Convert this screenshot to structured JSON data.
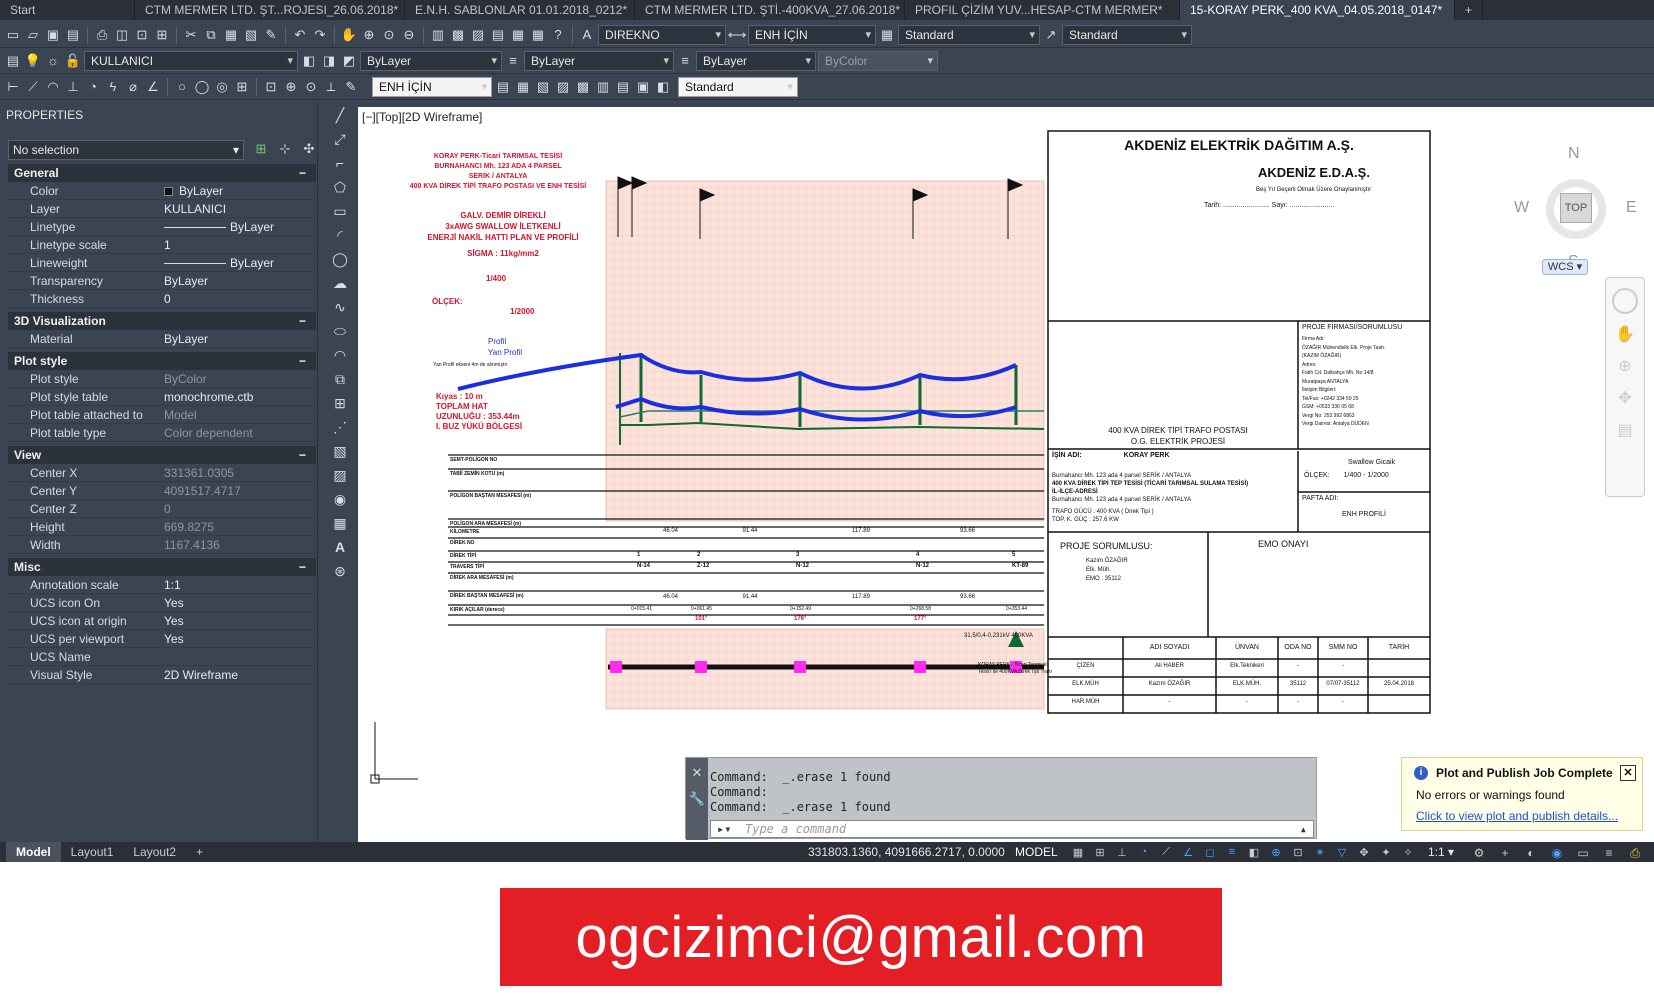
{
  "tabs": [
    {
      "label": "Start"
    },
    {
      "label": "CTM MERMER LTD. ŞT...ROJESI_26.06.2018*"
    },
    {
      "label": "E.N.H. SABLONLAR 01.01.2018_0212*"
    },
    {
      "label": "CTM MERMER LTD. ŞTİ.-400KVA_27.06.2018*"
    },
    {
      "label": "PROFIL ÇİZİM YUV...HESAP-CTM MERMER*"
    },
    {
      "label": "15-KORAY PERK_400 KVA_04.05.2018_0147*"
    }
  ],
  "toolbar1": {
    "textstyle": "DIREKNO",
    "dimstyle": "ENH İÇİN",
    "tablestyle": "Standard",
    "mleaderstyle": "Standard"
  },
  "toolbar2": {
    "layer": "KULLANICI",
    "color": "ByLayer",
    "linetype": "ByLayer",
    "lineweight": "ByLayer",
    "plotstyle": "ByColor"
  },
  "toolbar3": {
    "dimstyle": "ENH İÇİN",
    "standard": "Standard"
  },
  "properties": {
    "title": "PROPERTIES",
    "selection": "No selection",
    "sections": {
      "general": "General",
      "viz3d": "3D Visualization",
      "plot": "Plot style",
      "view": "View",
      "misc": "Misc"
    },
    "general": [
      {
        "k": "Color",
        "v": "ByLayer"
      },
      {
        "k": "Layer",
        "v": "KULLANICI"
      },
      {
        "k": "Linetype",
        "v": "ByLayer"
      },
      {
        "k": "Linetype scale",
        "v": "1"
      },
      {
        "k": "Lineweight",
        "v": "ByLayer"
      },
      {
        "k": "Transparency",
        "v": "ByLayer"
      },
      {
        "k": "Thickness",
        "v": "0"
      }
    ],
    "viz3d": [
      {
        "k": "Material",
        "v": "ByLayer"
      }
    ],
    "plot": [
      {
        "k": "Plot style",
        "v": "ByColor"
      },
      {
        "k": "Plot style table",
        "v": "monochrome.ctb"
      },
      {
        "k": "Plot table attached to",
        "v": "Model"
      },
      {
        "k": "Plot table type",
        "v": "Color dependent"
      }
    ],
    "view": [
      {
        "k": "Center X",
        "v": "331361.0305"
      },
      {
        "k": "Center Y",
        "v": "4091517.4717"
      },
      {
        "k": "Center Z",
        "v": "0"
      },
      {
        "k": "Height",
        "v": "669.8275"
      },
      {
        "k": "Width",
        "v": "1167.4136"
      }
    ],
    "misc": [
      {
        "k": "Annotation scale",
        "v": "1:1"
      },
      {
        "k": "UCS icon On",
        "v": "Yes"
      },
      {
        "k": "UCS icon at origin",
        "v": "Yes"
      },
      {
        "k": "UCS per viewport",
        "v": "Yes"
      },
      {
        "k": "UCS Name",
        "v": ""
      },
      {
        "k": "Visual Style",
        "v": "2D Wireframe"
      }
    ]
  },
  "viewport": {
    "label": "[−][Top][2D Wireframe]",
    "viewcube": {
      "top": "TOP",
      "n": "N",
      "s": "S",
      "e": "E",
      "w": "W"
    },
    "wcs": "WCS ▾",
    "drawing": {
      "title_red": [
        "KORAY PERK-Ticari TARIMSAL TESİSİ",
        "BURNAHANCI Mh. 123 ADA 4 PARSEL",
        "SERİK / ANTALYA",
        "400 KVA DİREK TİPİ TRAFO POSTASI VE ENH TESİSİ"
      ],
      "galv": [
        "GALV. DEMİR DİREKLİ",
        "3xAWG SWALLOW İLETKENLİ",
        "ENERJİ NAKİL HATTI PLAN VE PROFİLİ"
      ],
      "sigma": "SİGMA : 11kg/mm2",
      "scale_v": "1/400",
      "scale_h": "1/2000",
      "scale_label": "ÖLÇEK:",
      "legend": [
        "Profil",
        "Yan Profil"
      ],
      "legend_note": "Yan Profil ekseni 4m de alınmıştır",
      "kiyas": "Kıyas : 10 m",
      "toplam": "TOPLAM HAT",
      "uzunluk": "UZUNLUĞU : 353.44m",
      "buz": "I. BUZ YÜKÜ BÖLGESİ",
      "table_rows": [
        "SEMT-POLİGON NO",
        "TABİİ ZEMİN KOTU (m)",
        "POLİGON BAŞTAN MESAFESİ (m)",
        "POLİGON ARA MESAFESİ (m)",
        "KİLOMETRE",
        "DİREK NO",
        "DİREK TİPİ",
        "TRAVERS TİPİ",
        "DİREK ARA MESAFESİ (m)",
        "DİREK BAŞTAN MESAFESİ (m)",
        "KIRIK AÇILAR (derece)"
      ],
      "poles": [
        "1",
        "2",
        "3",
        "4",
        "5"
      ],
      "pole_types": [
        "N-14",
        "Z-12",
        "N-12",
        "N-12",
        "KT-89"
      ],
      "spans": [
        "46.04",
        "91.44",
        "117.89",
        "93.66"
      ],
      "distances": [
        "0+015.41",
        "0+061.45",
        "0+152.49",
        "0+268.58",
        "0+353.44"
      ],
      "angles": [
        "101°",
        "176°",
        "177°"
      ],
      "trafo_note": "KORAY PERK - Ticari Tarımsal Tesis'i ile 400KVA Direk Tipi Trafo",
      "end_label": "31,5/0,4-0,231kV 400KVA"
    },
    "titleblock": {
      "company": "AKDENİZ ELEKTRİK DAĞITIM A.Ş.",
      "company_short": "AKDENİZ E.D.A.Ş.",
      "approval": "Beş Yıl Geçerli Olmak Üzere Onaylanmıştır",
      "date_label": "Tarih: ........................ Sayı: .......................",
      "project_title": [
        "400 KVA DİREK TİPİ TRAFO POSTASI",
        "O.G. ELEKTRİK PROJESİ"
      ],
      "firm_label": "PROJE FİRMASI/SORUMLUSU",
      "firm_lines": [
        "Firma Adı:",
        "ÖZAĞIR Mühendislik Elk. Proje Taah.",
        "(KAZIM ÖZAĞIR)",
        "Adres:",
        "Fatih Cd. Dalbahçe Mh. No:14/8",
        "Muratpaşa ANTALYA",
        "İletişim Bilgileri:",
        "Tel/Fax: +0242 334 59 25",
        "GSM: +0533 336 05 68",
        "Vergi No: 253 992 6863",
        "Vergi Dairesi: Antalya DÜDEN"
      ],
      "work_name_label": "İŞİN ADI:",
      "work_name": "KORAY PERK",
      "work_desc": "400 KVA DİREK TİPİ TEP TESİSİ (TİCARİ TARIMSAL SULAMA TESİSİ)",
      "il_ilce": "İL-İLÇE-ADRESİ",
      "address": "Burnahancı Mh. 123 ada 4 parsel SERİK / ANTALYA",
      "trafo_gucu": "TRAFO GÜCÜ : 400 KVA ( Direk Tipi )",
      "top_kguc": "TOP. K. GÜÇ : 257.6 KW",
      "conductor": "Swallow Gicaik",
      "scale_label": "ÖLÇEK:",
      "scale_val": "1/400 - 1/2000",
      "sheet_label": "PAFTA ADI:",
      "sheet_name": "ENH PROFİLİ",
      "proje_sorumlusu": "PROJE SORUMLUSU:",
      "sorumlu_lines": [
        "Kazım ÖZAĞIR",
        "Elk. Müh.",
        "EMO : 35112"
      ],
      "emo": "EMO ONAYI",
      "sign_headers": [
        "ADI SOYADI",
        "ÜNVAN",
        "ODA NO",
        "SMM NO",
        "TARİH"
      ],
      "sign_rows": [
        {
          "role": "ÇİZEN",
          "name": "Ali HABER",
          "title": "Elk.Teknikeri",
          "oda": "-",
          "smm": "-",
          "date": ""
        },
        {
          "role": "ELK.MÜH",
          "name": "Kazım ÖZAĞIR",
          "title": "ELK.MÜH.",
          "oda": "35112",
          "smm": "07/07-35112",
          "date": "25.04.2018"
        },
        {
          "role": "HAR.MÜH",
          "name": "-",
          "title": "-",
          "oda": "-",
          "smm": "-",
          "date": ""
        }
      ]
    }
  },
  "command": {
    "lines": [
      "Command:  _.erase 1 found",
      "Command:",
      "Command:  _.erase 1 found"
    ],
    "placeholder": "Type a command"
  },
  "notification": {
    "title": "Plot and Publish Job Complete",
    "body": "No errors or warnings found",
    "link": "Click to view plot and publish details..."
  },
  "status": {
    "layouts": [
      "Model",
      "Layout1",
      "Layout2"
    ],
    "coords": "331803.1360, 4091666.2717, 0.0000",
    "model": "MODEL",
    "scale": "1:1 ▾"
  },
  "banner": {
    "email": "ogcizimci@gmail.com"
  },
  "colors": {
    "accent": "#e31e24",
    "ui_bg": "#3b4453",
    "profile_blue": "#1a2fe0",
    "profile_green": "#1b6b3a"
  }
}
